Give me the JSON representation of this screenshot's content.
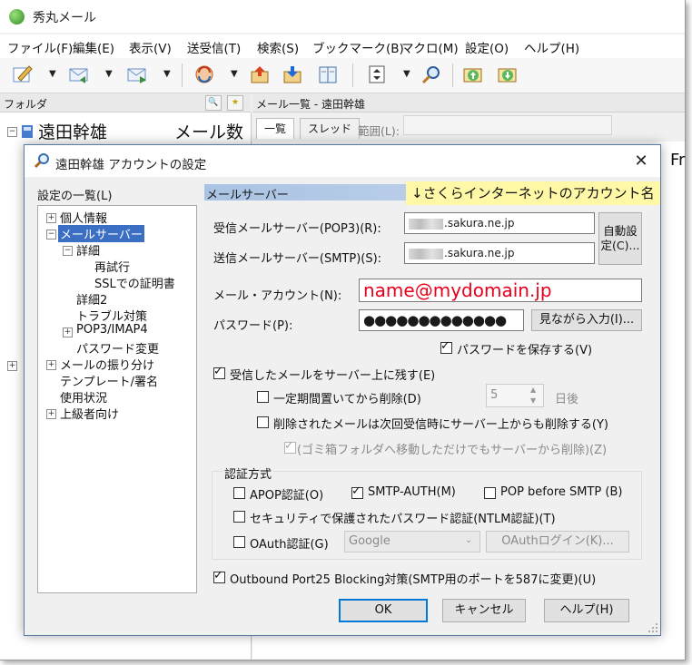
{
  "app": {
    "title": "秀丸メール"
  },
  "menu": [
    "ファイル(F)",
    "編集(E)",
    "表示(V)",
    "送受信(T)",
    "検索(S)",
    "ブックマーク(B)",
    "マクロ(M)",
    "設定(O)",
    "ヘルプ(H)"
  ],
  "toolbar": {
    "icons": [
      "compose-icon",
      "reply-icon",
      "forward-icon",
      "send-receive-icon",
      "send-icon",
      "receive-icon",
      "address-book-icon",
      "sort-icon",
      "search-icon",
      "upload-icon",
      "download-icon"
    ]
  },
  "folder_pane": {
    "header": "フォルダ",
    "search_btn": "🔍",
    "star_btn": "★",
    "root_label": "遠田幹雄",
    "mail_count_label": "メール数"
  },
  "list_pane": {
    "header": "メール一覧 - 遠田幹雄",
    "tabs": [
      "一覧",
      "スレッド"
    ],
    "range_label": "範囲(L):",
    "right_text": "Fr"
  },
  "dialog": {
    "title": "遠田幹雄 アカウントの設定",
    "close": "✕",
    "settings_list_label": "設定の一覧(L)",
    "tree": [
      {
        "label": "個人情報",
        "expander": "+"
      },
      {
        "label": "メールサーバー",
        "expander": "−",
        "selected": true
      },
      {
        "label": "詳細",
        "expander": "−"
      },
      {
        "label": "再試行"
      },
      {
        "label": "SSLでの証明書"
      },
      {
        "label": "詳細2"
      },
      {
        "label": "トラブル対策"
      },
      {
        "label": "POP3/IMAP4",
        "expander": "+"
      },
      {
        "label": "パスワード変更"
      },
      {
        "label": "メールの振り分け",
        "expander": "+"
      },
      {
        "label": "テンプレート/署名"
      },
      {
        "label": "使用状況"
      },
      {
        "label": "上級者向け",
        "expander": "+"
      }
    ],
    "section_label": "メールサーバー",
    "annotation": "↓さくらインターネットのアカウント名",
    "incoming_label": "受信メールサーバー(POP3)(R):",
    "incoming_value": ".sakura.ne.jp",
    "outgoing_label": "送信メールサーバー(SMTP)(S):",
    "outgoing_value": ".sakura.ne.jp",
    "auto_config_button": "自動設定(C)...",
    "account_label": "メール・アカウント(N):",
    "account_value": "name@mydomain.jp",
    "account_color": "#e8001c",
    "password_label": "パスワード(P):",
    "password_value": "●●●●●●●●●●●●●",
    "show_password_button": "見ながら入力(I)...",
    "save_password_label": "パスワードを保存する(V)",
    "save_password_checked": "✓",
    "leave_on_server_label": "受信したメールをサーバー上に残す(E)",
    "leave_on_server_checked": "✓",
    "delete_after_label": "一定期間置いてから削除(D)",
    "delete_after_days": "5",
    "days_unit": "日後",
    "delete_on_server_label": "削除されたメールは次回受信時にサーバー上からも削除する(Y)",
    "trash_label": "(ゴミ箱フォルダへ移動しただけでもサーバーから削除)(Z)",
    "trash_checked": "✓",
    "auth_group_label": "認証方式",
    "apop_label": "APOP認証(O)",
    "smtp_auth_label": "SMTP-AUTH(M)",
    "smtp_auth_checked": "✓",
    "pop_before_smtp_label": "POP before SMTP (B)",
    "ntlm_label": "セキュリティで保護されたパスワード認証(NTLM認証)(T)",
    "oauth_label": "OAuth認証(G)",
    "oauth_provider": "Google",
    "oauth_login_button": "OAuthログイン(K)...",
    "port25_label": "Outbound Port25 Blocking対策(SMTP用のポートを587に変更)(U)",
    "port25_checked": "✓",
    "ok_button": "OK",
    "cancel_button": "キャンセル",
    "help_button": "ヘルプ(H)"
  }
}
